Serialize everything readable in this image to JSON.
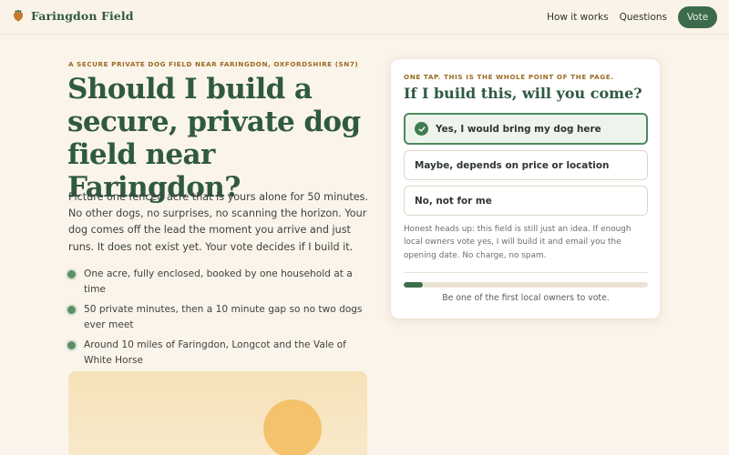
{
  "header": {
    "brand_name": "Faringdon Field",
    "brand_icon": "paw-shield-icon",
    "nav": {
      "how_it_works": "How it works",
      "questions": "Questions",
      "vote": "Vote"
    }
  },
  "hero": {
    "eyebrow": "A secure private dog field near Faringdon, Oxfordshire (SN7)",
    "headline": "Should I build a secure, private dog field near Faringdon?",
    "lede": "Picture one fenced acre that is yours alone for 50 minutes. No other dogs, no surprises, no scanning the horizon. Your dog comes off the lead the moment you arrive and just runs. It does not exist yet. Your vote decides if I build it.",
    "bullets": [
      "One acre, fully enclosed, booked by one household at a time",
      "50 private minutes, then a 10 minute gap so no two dogs ever meet",
      "Around 10 miles of Faringdon, Longcot and the Vale of White Horse"
    ]
  },
  "vote_card": {
    "eyebrow": "One tap. This is the whole point of the page.",
    "title": "If I build this, will you come?",
    "options": [
      {
        "label": "Yes, I would bring my dog here",
        "selected": true
      },
      {
        "label": "Maybe, depends on price or location",
        "selected": false
      },
      {
        "label": "No, not for me",
        "selected": false
      }
    ],
    "disclaimer": "Honest heads up: this field is still just an idea. If enough local owners vote yes, I will build it and email you the opening date. No charge, no spam.",
    "progress_fraction": 0.08,
    "progress_caption": "Be one of the first local owners to vote."
  },
  "colors": {
    "brand_green": "#2f5a40",
    "accent_gold": "#9a6b22",
    "background": "#fbf4ea",
    "sun": "#f3c26a"
  }
}
